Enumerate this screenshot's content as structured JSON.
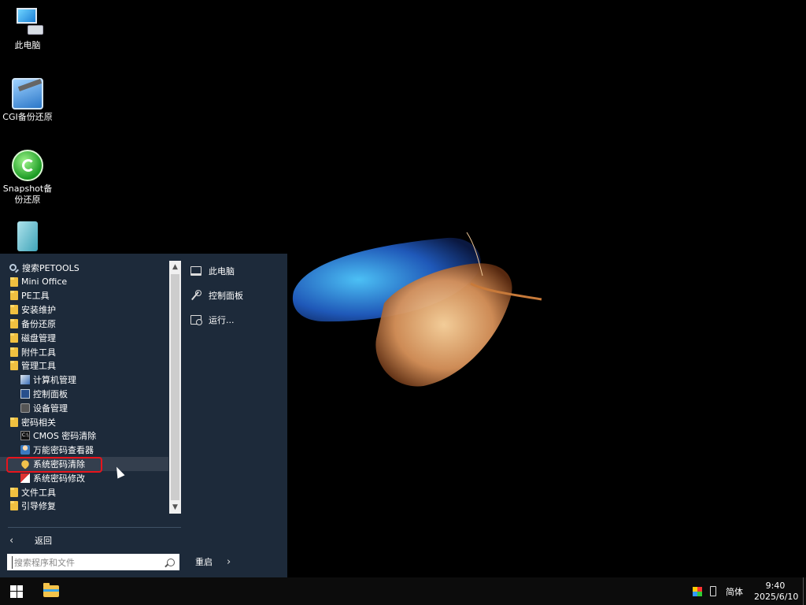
{
  "desktop": {
    "icons": [
      {
        "label": "此电脑"
      },
      {
        "label": "CGI备份还原"
      },
      {
        "label": "Snapshot备份还原"
      },
      {
        "label": ""
      }
    ]
  },
  "start_menu": {
    "items": [
      {
        "label": "搜索PETOOLS",
        "icon": "search-icon"
      },
      {
        "label": "Mini Office",
        "icon": "folder-icon"
      },
      {
        "label": "PE工具",
        "icon": "folder-icon"
      },
      {
        "label": "安装维护",
        "icon": "folder-icon"
      },
      {
        "label": "备份还原",
        "icon": "folder-icon"
      },
      {
        "label": "磁盘管理",
        "icon": "folder-icon"
      },
      {
        "label": "附件工具",
        "icon": "folder-icon"
      },
      {
        "label": "管理工具",
        "icon": "folder-icon"
      },
      {
        "label": "计算机管理",
        "icon": "computer-management-icon"
      },
      {
        "label": "控制面板",
        "icon": "control-panel-icon"
      },
      {
        "label": "设备管理",
        "icon": "device-manager-icon"
      },
      {
        "label": "密码相关",
        "icon": "folder-icon"
      },
      {
        "label": "CMOS 密码清除",
        "icon": "cmd-icon"
      },
      {
        "label": "万能密码查看器",
        "icon": "password-viewer-icon"
      },
      {
        "label": "系统密码清除",
        "icon": "key-icon"
      },
      {
        "label": "系统密码修改",
        "icon": "password-edit-icon"
      },
      {
        "label": "文件工具",
        "icon": "folder-icon"
      },
      {
        "label": "引导修复",
        "icon": "folder-icon"
      }
    ],
    "back_label": "返回",
    "search_placeholder": "搜索程序和文件",
    "right": {
      "this_pc": "此电脑",
      "control_panel": "控制面板",
      "run": "运行...",
      "restart": "重启"
    }
  },
  "taskbar": {
    "ime": "简体",
    "time": "9:40",
    "date": "2025/6/10"
  }
}
